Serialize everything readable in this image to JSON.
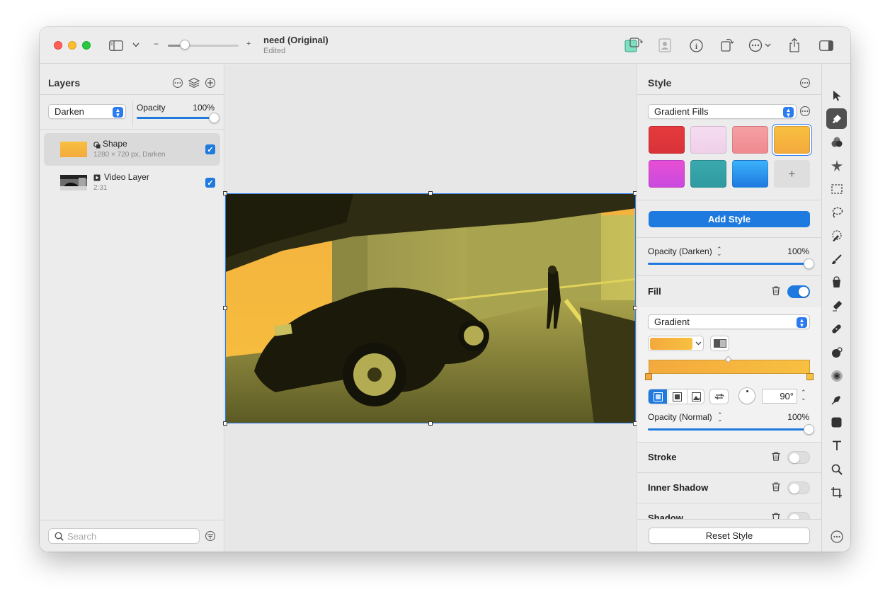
{
  "window": {
    "title": "need (Original)",
    "subtitle": "Edited"
  },
  "toolbar": {
    "zoom_minus": "−",
    "zoom_plus": "+",
    "zoom_level": 0.24,
    "icons": [
      "sidebar-toggle-icon",
      "chevron-down-icon",
      "image-swap-icon",
      "portrait-icon",
      "info-icon",
      "rotate-icon",
      "more-icon",
      "share-icon",
      "inspector-toggle-icon"
    ]
  },
  "layers_panel": {
    "title": "Layers",
    "blend_mode": "Darken",
    "opacity_label": "Opacity",
    "opacity_value": "100%",
    "opacity": 1.0,
    "layers": [
      {
        "name": "Shape",
        "detail": "1280 × 720 px, Darken",
        "checked": true,
        "selected": true,
        "icon": "shape-icon"
      },
      {
        "name": "Video Layer",
        "detail": "2:31",
        "checked": true,
        "selected": false,
        "icon": "play-icon"
      }
    ],
    "search_placeholder": "Search"
  },
  "style_panel": {
    "title": "Style",
    "preset_category": "Gradient Fills",
    "swatches": [
      {
        "color_a": "#e53a3c",
        "color_b": "#d8333a",
        "selected": false
      },
      {
        "color_a": "#f5dcf1",
        "color_b": "#efd0ea",
        "selected": false
      },
      {
        "color_a": "#f5a0a4",
        "color_b": "#ef8a90",
        "selected": false
      },
      {
        "color_a": "#f7c040",
        "color_b": "#f4a93d",
        "selected": true
      },
      {
        "color_a": "#e84fd2",
        "color_b": "#c94ae0",
        "selected": false
      },
      {
        "color_a": "#3aa9ad",
        "color_b": "#2f9aa0",
        "selected": false
      },
      {
        "color_a": "#3ab2fb",
        "color_b": "#1f7ae0",
        "selected": false
      }
    ],
    "add_swatch": "+",
    "add_style_label": "Add Style",
    "style_opacity_label": "Opacity (Darken)",
    "style_opacity_value": "100%",
    "style_opacity": 1.0,
    "fill": {
      "label": "Fill",
      "enabled": true,
      "type": "Gradient",
      "gradient_start": "#f4a93d",
      "gradient_end": "#f7c040",
      "angle": "90°",
      "opacity_label": "Opacity (Normal)",
      "opacity_value": "100%",
      "opacity": 1.0
    },
    "stroke": {
      "label": "Stroke",
      "enabled": false
    },
    "inner_shadow": {
      "label": "Inner Shadow",
      "enabled": false
    },
    "shadow": {
      "label": "Shadow",
      "enabled": false
    },
    "reset_label": "Reset Style"
  },
  "tools": [
    "arrow-icon",
    "style-brush-icon",
    "color-adjust-icon",
    "effects-icon",
    "rect-select-icon",
    "lasso-icon",
    "quick-select-icon",
    "paint-brush-icon",
    "paint-bucket-icon",
    "eraser-icon",
    "repair-icon",
    "clone-icon",
    "noise-icon",
    "pen-icon",
    "shape-tool-icon",
    "text-tool-icon",
    "zoom-tool-icon",
    "crop-icon",
    "more-tools-icon"
  ],
  "accent_color": "#1f7ae0"
}
